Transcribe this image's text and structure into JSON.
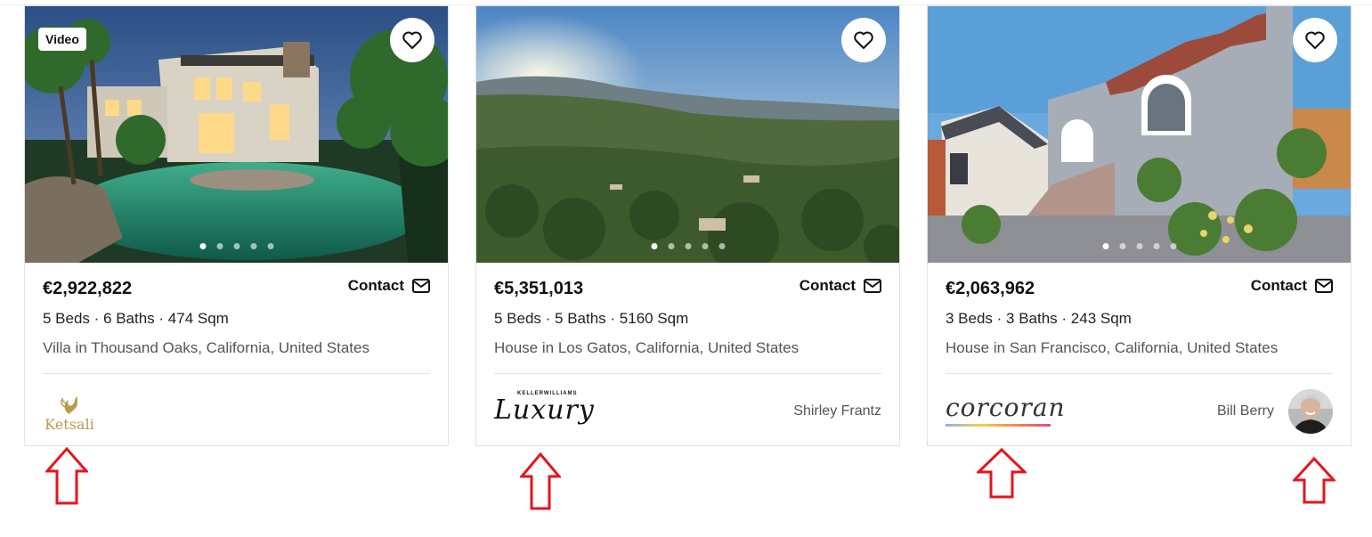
{
  "listings": [
    {
      "badge": "Video",
      "price": "€2,922,822",
      "contact_label": "Contact",
      "specs": "5 Beds · 6 Baths · 474 Sqm",
      "location": "Villa in Thousand Oaks, California, United States",
      "logo_text": "Ketsali",
      "agent_name": "",
      "photo_count": 5,
      "active_photo": 1
    },
    {
      "badge": "",
      "price": "€5,351,013",
      "contact_label": "Contact",
      "specs": "5 Beds · 5 Baths · 5160 Sqm",
      "location": "House in Los Gatos, California, United States",
      "logo_text_small": "KELLERWILLIAMS",
      "logo_text": "Luxury",
      "agent_name": "Shirley Frantz",
      "photo_count": 5,
      "active_photo": 1
    },
    {
      "badge": "",
      "price": "€2,063,962",
      "contact_label": "Contact",
      "specs": "3 Beds · 3 Baths · 243 Sqm",
      "location": "House in San Francisco, California, United States",
      "logo_text": "corcoran",
      "agent_name": "Bill Berry",
      "photo_count": 5,
      "active_photo": 1
    }
  ],
  "icons": {
    "favorite": "heart-outline-icon",
    "contact": "envelope-icon",
    "annotation": "red-up-arrow-icon"
  },
  "colors": {
    "annotation_arrow": "#e3161e",
    "ketsali_gold": "#b89a4a"
  }
}
